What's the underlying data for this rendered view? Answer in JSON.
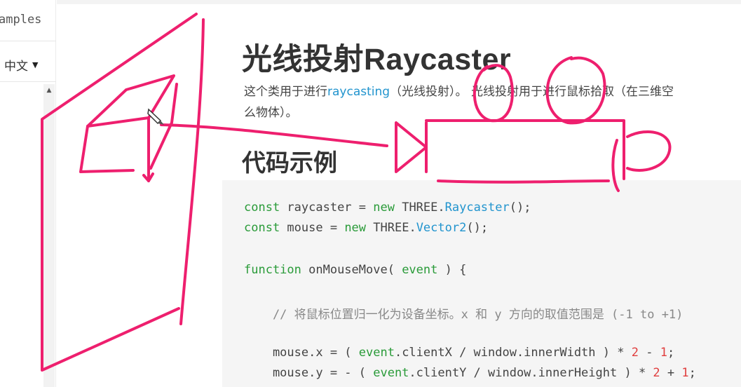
{
  "sidebar": {
    "examples_label": "amples",
    "lang_label": "中文",
    "lang_caret": "▼",
    "scroll_up": "▲"
  },
  "main": {
    "title": "光线投射Raycaster",
    "desc_before": "这个类用于进行",
    "desc_link": "raycasting",
    "desc_after": "（光线投射）。 光线投射用于进行鼠标拾取（在三维空",
    "desc_line2": "么物体）。",
    "section_heading": "代码示例"
  },
  "code": {
    "l1": {
      "kw": "const",
      "a": " raycaster = ",
      "kw2": "new",
      "b": " THREE.",
      "cls": "Raycaster",
      "c": "();"
    },
    "l2": {
      "kw": "const",
      "a": " mouse = ",
      "kw2": "new",
      "b": " THREE.",
      "cls": "Vector2",
      "c": "();"
    },
    "l3": {
      "kw": "function",
      "a": " onMouseMove( ",
      "kw2": "event",
      "b": " ) {"
    },
    "l4": {
      "cmt": "    // 将鼠标位置归一化为设备坐标。x 和 y 方向的取值范围是 (-1 to +1)"
    },
    "l5": {
      "a": "    mouse.x = ( ",
      "kw": "event",
      "b": ".clientX / window.innerWidth ) * ",
      "n1": "2",
      "c": " - ",
      "n2": "1",
      "d": ";"
    },
    "l6": {
      "a": "    mouse.y = - ( ",
      "kw": "event",
      "b": ".clientY / window.innerHeight ) * ",
      "n1": "2",
      "c": " + ",
      "n2": "1",
      "d": ";"
    }
  },
  "colors": {
    "link": "#2194ce",
    "keyword": "#2a9b39",
    "number": "#e03e3e",
    "pen": "#ee1f6e"
  },
  "icons": {
    "cursor": "pencil-cursor-icon"
  }
}
